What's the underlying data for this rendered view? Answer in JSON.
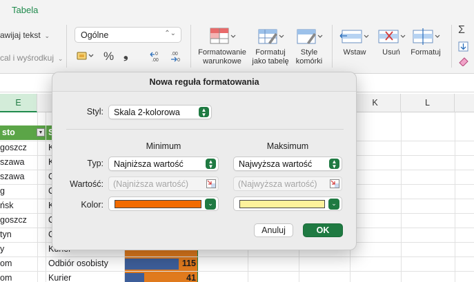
{
  "ribbon": {
    "tab_label": "Tabela",
    "wrap_text": "awijaj tekst",
    "merge_center": "cal i wyśrodkuj",
    "number_format": "Ogólne",
    "percent_symbol": "%",
    "comma_symbol": "❟",
    "buttons": {
      "conditional_formatting": [
        "Formatowanie",
        "warunkowe"
      ],
      "format_as_table": [
        "Formatuj",
        "jako tabelę"
      ],
      "cell_styles": [
        "Style",
        "komórki"
      ],
      "insert": "Wstaw",
      "delete": "Usuń",
      "format": "Formatuj"
    }
  },
  "sheet": {
    "columns": {
      "e": "E",
      "k": "K",
      "l": "L"
    },
    "header_cell_fragment": "sto",
    "header_cell_next": "S",
    "rows": [
      {
        "city": "goszcz",
        "method": "K",
        "value": ""
      },
      {
        "city": "szawa",
        "method": "K",
        "value": ""
      },
      {
        "city": "szawa",
        "method": "O",
        "value": ""
      },
      {
        "city": "g",
        "method": "O",
        "value": ""
      },
      {
        "city": "ńsk",
        "method": "K",
        "value": ""
      },
      {
        "city": "goszcz",
        "method": "O",
        "value": ""
      },
      {
        "city": "tyn",
        "method": "O",
        "value": ""
      },
      {
        "city": "y",
        "method": "Kurier",
        "value": ""
      },
      {
        "city": "om",
        "method": "Odbiór osobisty",
        "value": "115"
      },
      {
        "city": "om",
        "method": "Kurier",
        "value": "41"
      }
    ]
  },
  "dialog": {
    "title": "Nowa reguła formatowania",
    "style_label": "Styl:",
    "style_value": "Skala 2-kolorowa",
    "min_header": "Minimum",
    "max_header": "Maksimum",
    "type_label": "Typ:",
    "min_type": "Najniższa wartość",
    "max_type": "Najwyższa wartość",
    "value_label": "Wartość:",
    "min_value_placeholder": "(Najniższa wartość)",
    "max_value_placeholder": "(Najwyższa wartość)",
    "color_label": "Kolor:",
    "min_color": "#f26b00",
    "max_color": "#fdf29b",
    "cancel_label": "Anuluj",
    "ok_label": "OK"
  },
  "colors": {
    "accent_green": "#1f7a42",
    "header_green": "#5ba547",
    "databar_blue": "#3d5e99",
    "databar_orange": "#e07a1d"
  }
}
